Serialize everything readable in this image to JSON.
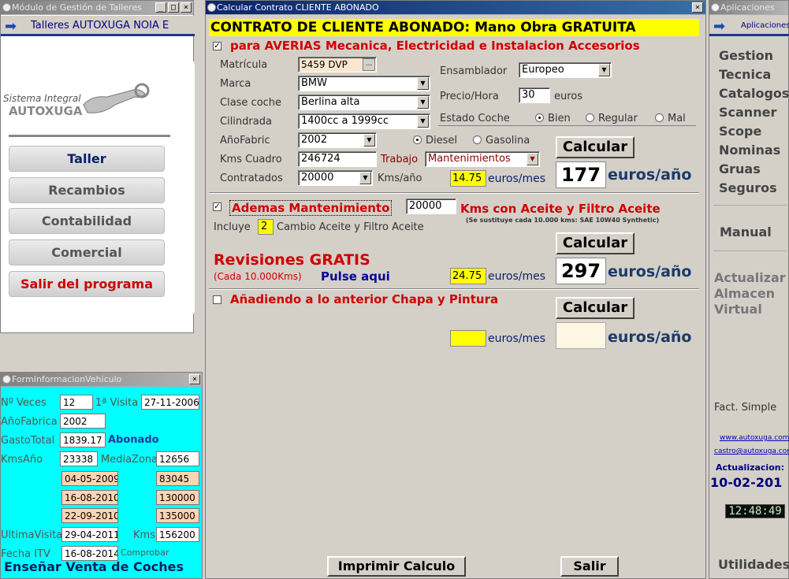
{
  "left_window": {
    "title": "Módulo de Gestión de Talleres",
    "header": "Talleres AUTOXUGA NOIA E",
    "logo_line1": "Sistema Integral",
    "logo_line2": "AUTOXUGA",
    "buttons": [
      "Taller",
      "Recambios",
      "Contabilidad",
      "Comercial",
      "Salir del programa"
    ]
  },
  "info_window": {
    "title": "FormInformacionVehiculo",
    "labels": {
      "veces": "Nº Veces",
      "primera": "1ª Visita",
      "anio": "AñoFabrica",
      "gasto": "GastoTotal",
      "abonado": "Abonado",
      "kmsanio": "KmsAño",
      "mediazona": "MediaZona",
      "ultima": "UltimaVisita",
      "kms": "Kms.",
      "itv": "Fecha ITV",
      "comprobar": "Comprobar"
    },
    "values": {
      "veces": "12",
      "primera": "27-11-2006",
      "anio": "2002",
      "gasto": "1839.17",
      "kmsanio": "23338",
      "mediazona": "12656",
      "ultima": "29-04-2011",
      "kms": "156200",
      "itv": "16-08-2014"
    },
    "history": [
      {
        "date": "04-05-2009",
        "km": "83045"
      },
      {
        "date": "16-08-2010",
        "km": "130000"
      },
      {
        "date": "22-09-2010",
        "km": "135000"
      }
    ],
    "footer": "Enseñar Venta de Coches"
  },
  "main_window": {
    "title": "Calcular Contrato CLIENTE ABONADO",
    "heading": "CONTRATO DE CLIENTE ABONADO: Mano Obra GRATUITA",
    "sec1": {
      "title": "para AVERIAS Mecanica, Electricidad e Instalacion Accesorios",
      "labels": {
        "matricula": "Matrícula",
        "marca": "Marca",
        "clase": "Clase coche",
        "cilindrada": "Cilindrada",
        "anio": "AñoFabric",
        "kms": "Kms Cuadro",
        "contratados": "Contratados",
        "kmsanio": "Kms/año",
        "ensamblador": "Ensamblador",
        "precio": "Precio/Hora",
        "euros": "euros",
        "estado": "Estado Coche",
        "trabajo": "Trabajo"
      },
      "values": {
        "matricula": "5459 DVP",
        "matricula_btn": "...",
        "marca": "BMW",
        "clase": "Berlina alta",
        "cilindrada": "1400cc a 1999cc",
        "anio": "2002",
        "kms": "246724",
        "contratados": "20000",
        "ensamblador": "Europeo",
        "precio": "30",
        "trabajo": "Mantenimientos"
      },
      "estado_opts": [
        "Bien",
        "Regular",
        "Mal"
      ],
      "estado_sel": 0,
      "fuel_opts": [
        "Diesel",
        "Gasolina"
      ],
      "fuel_sel": 0,
      "calc": "Calcular",
      "mes_val": "14.75",
      "mes_lbl": "euros/mes",
      "anio_val": "177",
      "anio_lbl": "euros/año"
    },
    "sec2": {
      "title": "Ademas Mantenimiento",
      "kms_val": "20000",
      "kms_lbl": "Kms con Aceite y Filtro Aceite",
      "note": "(Se sustituye cada 10.000 kms: SAE 10W40 Synthetic)",
      "incluye": "Incluye",
      "incluye_val": "2",
      "cambio": "Cambio Aceite y Filtro Aceite",
      "calc": "Calcular",
      "rev": "Revisiones GRATIS",
      "rev_sub": "(Cada 10.000Kms)",
      "pulse": "Pulse aqui",
      "mes_val": "24.75",
      "mes_lbl": "euros/mes",
      "anio_val": "297",
      "anio_lbl": "euros/año"
    },
    "sec3": {
      "title": "Añadiendo a lo anterior Chapa y Pintura",
      "calc": "Calcular",
      "mes_lbl": "euros/mes",
      "anio_lbl": "euros/año"
    },
    "print": "Imprimir Calculo",
    "exit": "Salir"
  },
  "right_window": {
    "title": "Aplicaciones",
    "header": "Aplicaciones",
    "menu": [
      "Gestion",
      "Tecnica",
      "Catalogos",
      "Scanner",
      "Scope",
      "Nominas",
      "Gruas",
      "Seguros"
    ],
    "manual": "Manual",
    "actualizar": [
      "Actualizar",
      "Almacen",
      "Virtual"
    ],
    "fact": "Fact. Simple",
    "web": "www.autoxuga.com",
    "email": "castro@autoxuga.com",
    "act_lbl": "Actualizacion:",
    "act_date": "10-02-201",
    "clock": "12:48:49",
    "util": "Utilidades"
  },
  "colors": {
    "cyan": "#00ffff",
    "yellow": "#ffff00",
    "red": "#e00000",
    "navy": "#000080",
    "darkblue": "#1a3a6a"
  }
}
